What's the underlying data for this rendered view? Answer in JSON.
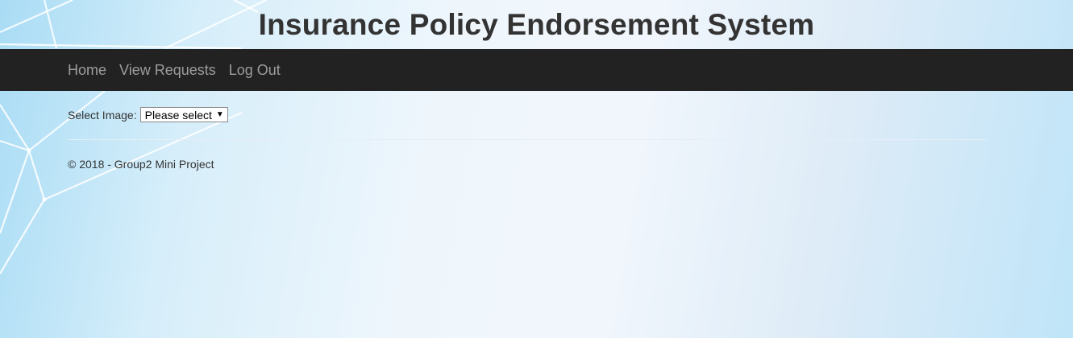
{
  "header": {
    "title": "Insurance Policy Endorsement System"
  },
  "nav": {
    "items": [
      {
        "label": "Home"
      },
      {
        "label": "View Requests"
      },
      {
        "label": "Log Out"
      }
    ]
  },
  "form": {
    "select_label": "Select Image:",
    "select_value": "Please select",
    "select_icon": "dropdown-arrow",
    "select_arrow_glyph": "▼"
  },
  "footer": {
    "text": "© 2018 - Group2 Mini Project"
  },
  "colors": {
    "navbar_bg": "#222222",
    "nav_link": "#9d9d9d",
    "title_text": "#333333"
  }
}
